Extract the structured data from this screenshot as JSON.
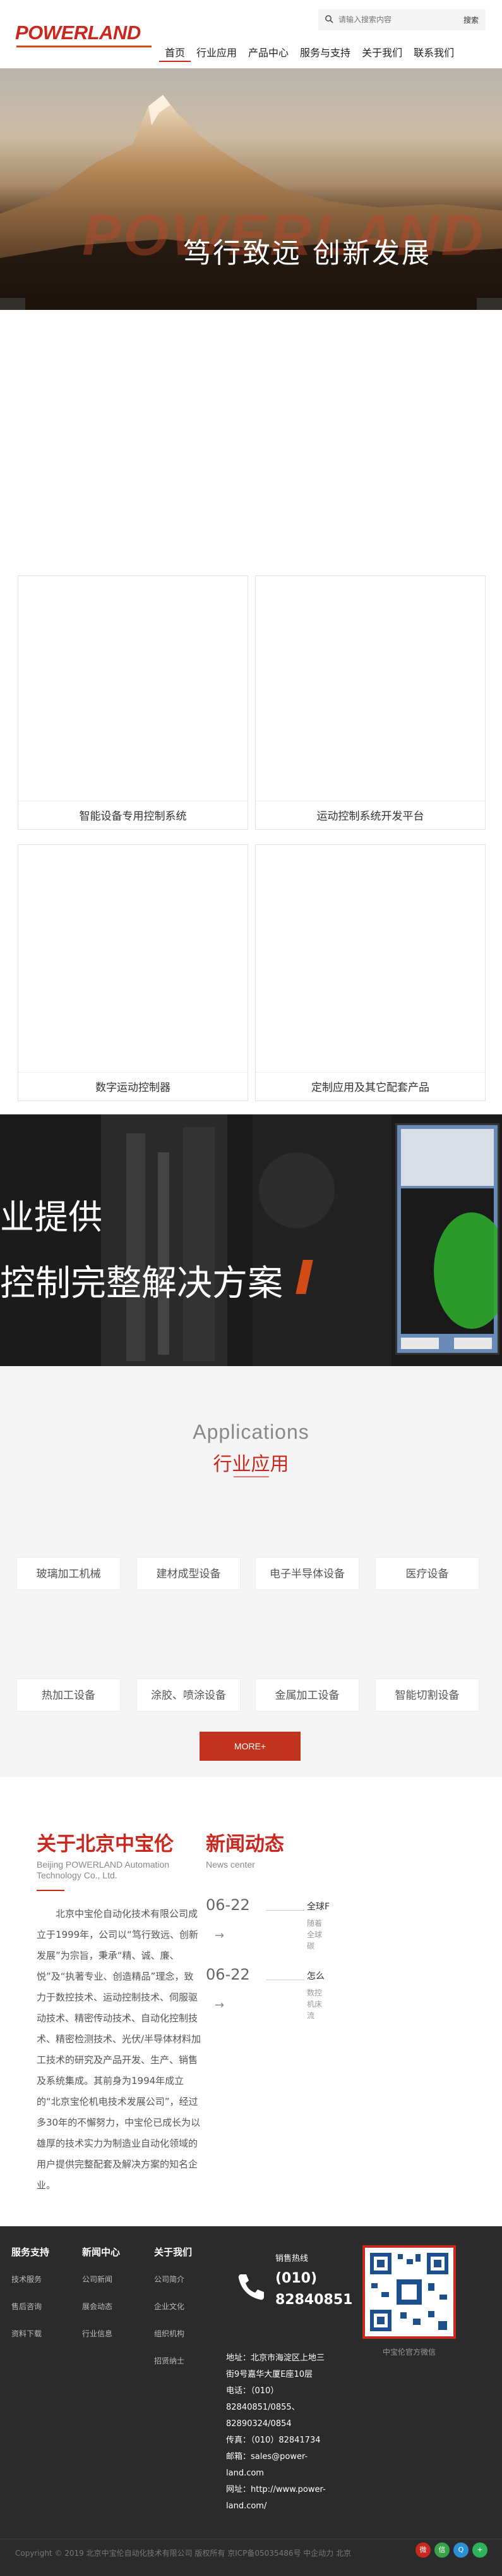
{
  "header": {
    "logo": "POWERLAND",
    "search_placeholder": "请输入搜索内容",
    "search_button": "搜索",
    "nav": [
      "首页",
      "行业应用",
      "产品中心",
      "服务与支持",
      "关于我们",
      "联系我们"
    ]
  },
  "hero": {
    "watermark": "POWERLAND",
    "slogan": "笃行致远  创新发展",
    "prev_arrow": "‹",
    "next_arrow": "›"
  },
  "products": [
    "智能设备专用控制系统",
    "运动控制系统开发平台",
    "数字运动控制器",
    "定制应用及其它配套产品"
  ],
  "banner2": {
    "line1": "业提供",
    "line2": "控制完整解决方案"
  },
  "applications": {
    "title_en": "Applications",
    "title_cn": "行业应用",
    "items": [
      "玻璃加工机械",
      "建材成型设备",
      "电子半导体设备",
      "医疗设备",
      "热加工设备",
      "涂胶、喷涂设备",
      "金属加工设备",
      "智能切割设备"
    ],
    "more": "MORE+"
  },
  "about": {
    "title": "关于北京中宝伦",
    "subtitle_en": "Beijing POWERLAND Automation Technology Co., Ltd.",
    "body": "北京中宝伦自动化技术有限公司成立于1999年，公司以“笃行致远、创新发展”为宗旨，秉承“精、诚、廉、悦”及“执著专业、创造精品”理念，致力于数控技术、运动控制技术、伺服驱动技术、精密传动技术、自动化控制技术、精密检测技术、光伏/半导体材料加工技术的研究及产品开发、生产、销售及系统集成。其前身为1994年成立的“北京宝伦机电技术发展公司”，经过多30年的不懈努力，中宝伦已成长为以雄厚的技术实力为制造业自动化领域的用户提供完整配套及解决方案的知名企业。"
  },
  "news": {
    "title": "新闻动态",
    "subtitle_en": "News center",
    "items": [
      {
        "date": "06-22",
        "arrow": "→",
        "headline": "全球F",
        "summary": "随着全球碳中..."
      },
      {
        "date": "06-22",
        "arrow": "→",
        "headline": "怎么",
        "summary": "数控机床流程..."
      }
    ]
  },
  "footer": {
    "columns": [
      {
        "title": "服务支持",
        "items": [
          "技术服务",
          "售后咨询",
          "资料下载"
        ]
      },
      {
        "title": "新闻中心",
        "items": [
          "公司新闻",
          "展会动态",
          "行业信息"
        ]
      },
      {
        "title": "关于我们",
        "items": [
          "公司简介",
          "企业文化",
          "组织机构",
          "招贤纳士"
        ]
      }
    ],
    "hotline_label": "销售热线",
    "hotline_number": "(010) 82840851",
    "contact_lines": [
      "地址：北京市海淀区上地三街9号嘉华大厦E座10层",
      "电话：（010）82840851/0855、82890324/0854",
      "传真：（010）82841734",
      "邮箱：sales@power-land.com",
      "网址：http://www.power-land.com/"
    ],
    "qr_caption": "中宝伦官方微信",
    "copyright": "Copyright © 2019 北京中宝伦自动化技术有限公司 版权所有 京ICP备05035486号 中企动力 北京"
  },
  "colors": {
    "brand": "#c8281e",
    "accent": "#d04a1a",
    "footer_bg": "#2b2b2b"
  }
}
